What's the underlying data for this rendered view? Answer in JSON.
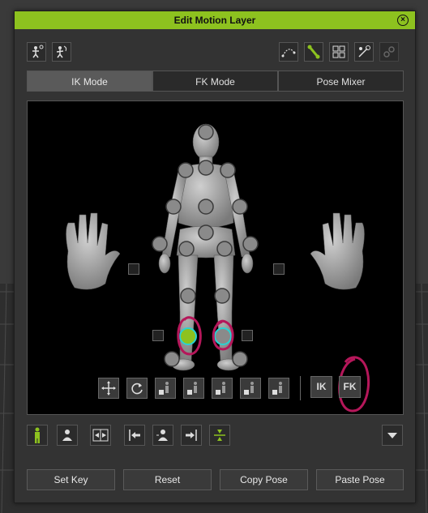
{
  "window": {
    "title": "Edit Motion Layer",
    "close_icon": "close-circle-icon"
  },
  "toolbar_left": [
    {
      "name": "reach-target-icon"
    },
    {
      "name": "pose-select-icon"
    }
  ],
  "toolbar_right": [
    {
      "name": "curve-path-icon",
      "active": false
    },
    {
      "name": "bone-link-icon",
      "active": true
    },
    {
      "name": "grid-select-icon",
      "active": false
    },
    {
      "name": "pick-target-icon",
      "active": false
    },
    {
      "name": "chain-disabled-icon",
      "active": false
    }
  ],
  "tabs": [
    {
      "label": "IK Mode",
      "active": true
    },
    {
      "label": "FK Mode",
      "active": false
    },
    {
      "label": "Pose Mixer",
      "active": false
    }
  ],
  "viewport": {
    "mode_buttons": {
      "ik": "IK",
      "fk": "FK"
    },
    "selected_joint": "left-knee",
    "accent_color": "#8dc21f",
    "highlight_color": "#b5175a"
  },
  "bottom_toolbar": [
    {
      "name": "full-body-icon",
      "active": true
    },
    {
      "name": "upper-body-icon"
    },
    {
      "name": "mirror-icon"
    },
    {
      "name": "align-left-icon"
    },
    {
      "name": "avatar-icon"
    },
    {
      "name": "align-right-icon"
    },
    {
      "name": "center-icon",
      "active": true
    },
    {
      "name": "dropdown-icon"
    }
  ],
  "actions": {
    "set_key": "Set Key",
    "reset": "Reset",
    "copy_pose": "Copy Pose",
    "paste_pose": "Paste Pose"
  }
}
